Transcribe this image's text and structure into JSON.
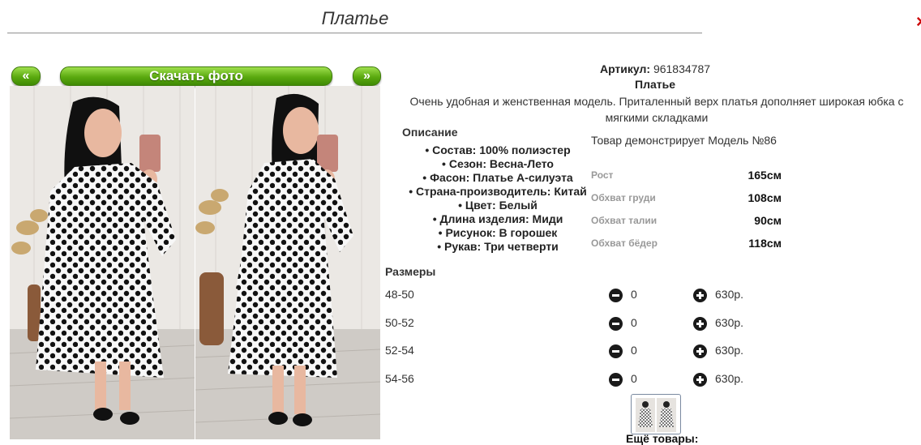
{
  "page": {
    "title": "Платье",
    "close_glyph": "×"
  },
  "gallery": {
    "prev_label": "«",
    "download_label": "Скачать фото",
    "next_label": "»"
  },
  "product": {
    "article_label": "Артикул:",
    "article_value": "961834787",
    "name": "Платье",
    "description": "Очень удобная и женственная модель. Приталенный верх платья дополняет широкая юбка с мягкими складками"
  },
  "specs": {
    "heading": "Описание",
    "items": [
      "Состав: 100% полиэстер",
      "Сезон: Весна-Лето",
      "Фасон: Платье А-силуэта",
      "Страна-производитель: Китай",
      "Цвет: Белый",
      "Длина изделия: Миди",
      "Рисунок: В горошек",
      "Рукав: Три четверти"
    ]
  },
  "model": {
    "text": "Товар демонстрирует Модель №86",
    "measurements": [
      {
        "label": "Рост",
        "value": "165см"
      },
      {
        "label": "Обхват груди",
        "value": "108см"
      },
      {
        "label": "Обхват талии",
        "value": "90см"
      },
      {
        "label": "Обхват бёдер",
        "value": "118см"
      }
    ]
  },
  "sizes": {
    "heading": "Размеры",
    "rows": [
      {
        "size": "48-50",
        "qty": "0",
        "price": "630р."
      },
      {
        "size": "50-52",
        "qty": "0",
        "price": "630р."
      },
      {
        "size": "52-54",
        "qty": "0",
        "price": "630р."
      },
      {
        "size": "54-56",
        "qty": "0",
        "price": "630р."
      }
    ]
  },
  "more": {
    "label": "Ещё товары:"
  },
  "colors": {
    "button_green": "#5aa90f",
    "dress_white": "#f7f7f7",
    "polka_dot": "#111111",
    "wall": "#e9e6e2"
  }
}
